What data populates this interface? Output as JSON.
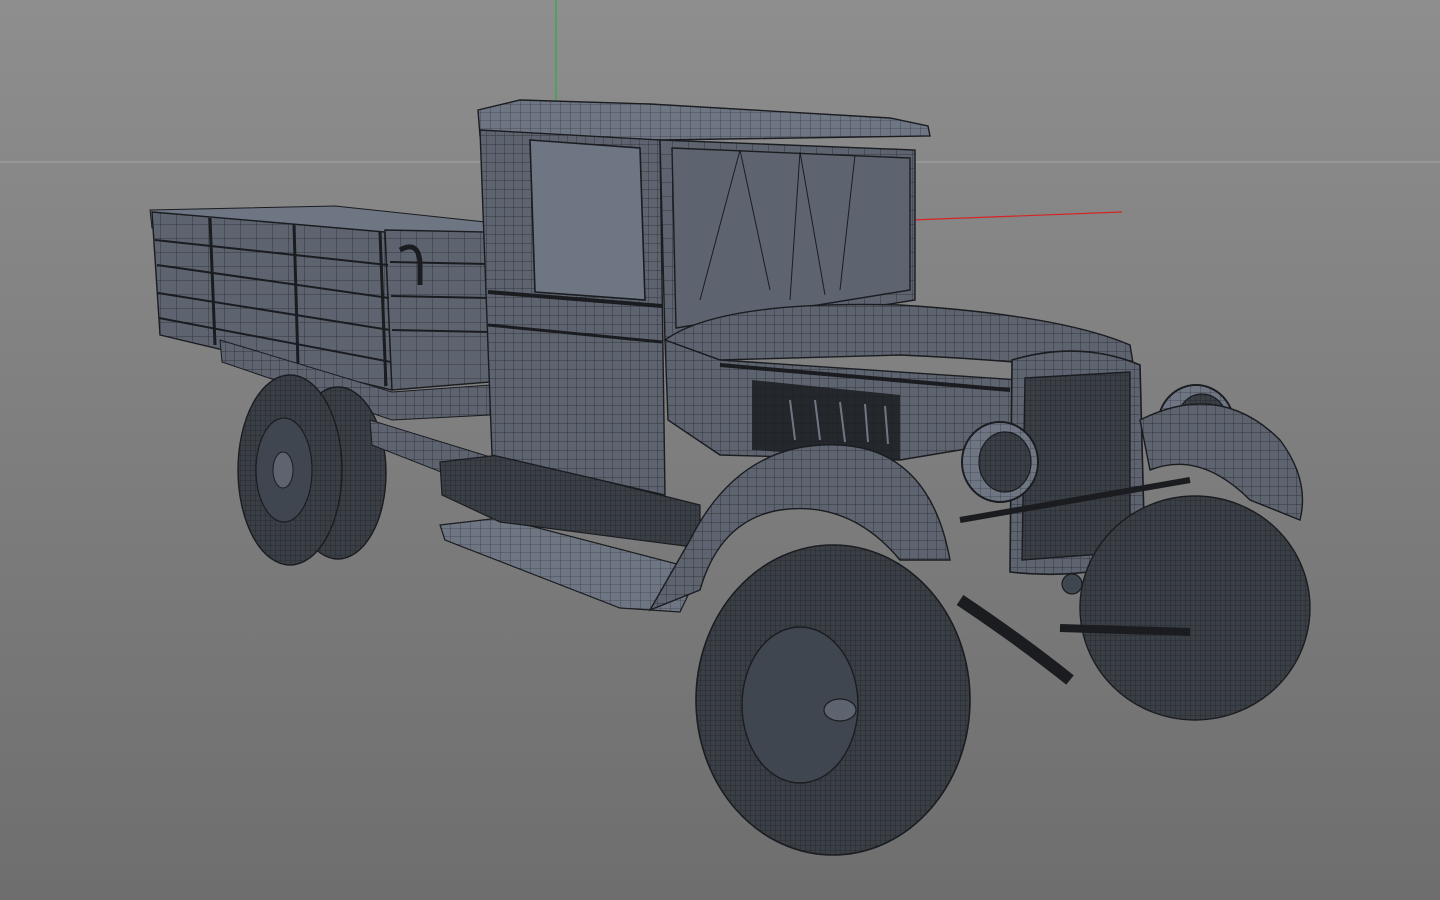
{
  "viewport": {
    "background_top": "#8e8e8e",
    "background_bottom": "#6e6e6e",
    "horizon_line_color": "#a4a4a4",
    "axis_x_color": "#d42424",
    "axis_y_color": "#2fae3a",
    "axis_z_color": "#2a3fd8"
  },
  "model": {
    "shaded_color": "#5d6470",
    "shaded_light_color": "#6f7683",
    "shaded_dark_color": "#40464f",
    "wire_color": "#1a1c20",
    "tire_color": "#3a3f46"
  }
}
